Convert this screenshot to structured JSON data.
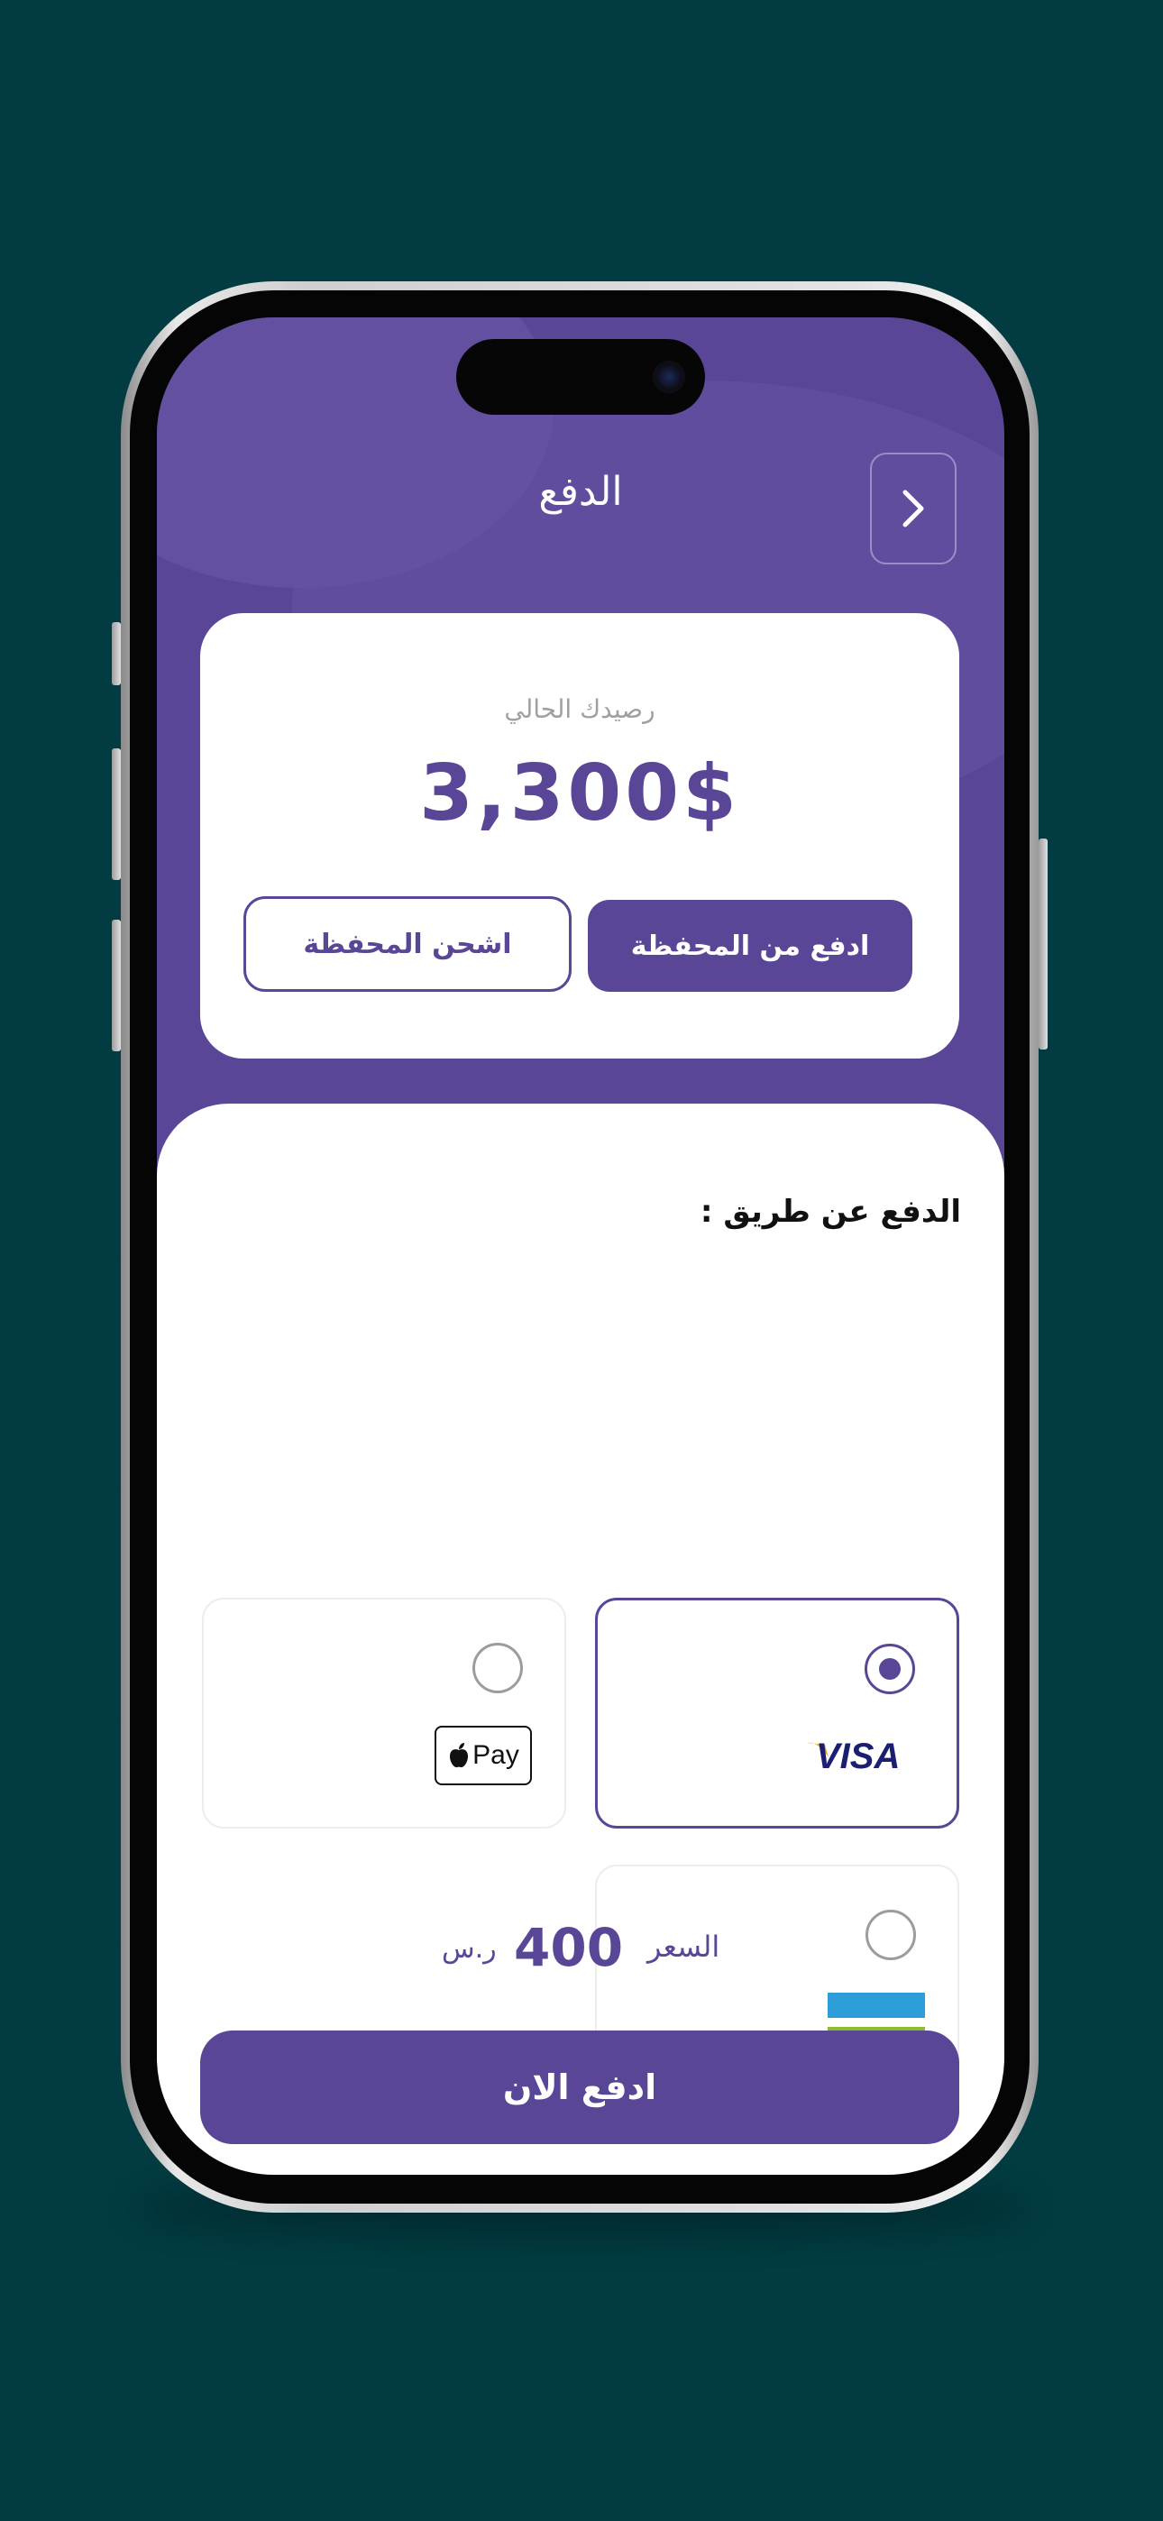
{
  "header": {
    "title": "الدفع",
    "back_icon": "chevron-right-icon"
  },
  "wallet": {
    "balance_label": "رصيدك الحالي",
    "balance_amount": "3,300$",
    "pay_from_wallet_label": "ادفع من المحفظة",
    "charge_wallet_label": "اشحن المحفظة"
  },
  "payment_methods": {
    "title": "الدفع عن طريق :",
    "items": [
      {
        "id": "visa",
        "logo_text": "VISA",
        "selected": true
      },
      {
        "id": "apple-pay",
        "logo_text": "Pay",
        "selected": false
      },
      {
        "id": "bank-transfer",
        "selected": false
      }
    ]
  },
  "price": {
    "label": "السعر",
    "value": "400",
    "currency": "ر.س"
  },
  "actions": {
    "pay_now_label": "ادفع الان"
  },
  "colors": {
    "background": "#023B41",
    "primary": "#5A4697",
    "visa_blue": "#1A1F71",
    "visa_gold": "#F7A823",
    "bank_blue": "#2D9DD8",
    "bank_green": "#8BBE2C"
  }
}
